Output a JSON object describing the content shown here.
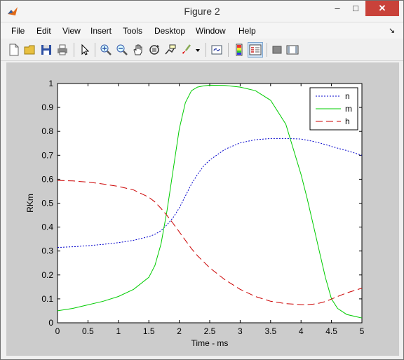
{
  "window": {
    "title": "Figure 2",
    "minimize_label": "–",
    "maximize_label": "□",
    "close_label": "✕"
  },
  "menu": [
    "File",
    "Edit",
    "View",
    "Insert",
    "Tools",
    "Desktop",
    "Window",
    "Help"
  ],
  "menu_arrow": "↘",
  "toolbar_icons": [
    "new-figure-icon",
    "open-file-icon",
    "save-icon",
    "print-icon",
    "edit-plot-arrow-icon",
    "zoom-in-icon",
    "zoom-out-icon",
    "pan-hand-icon",
    "rotate-3d-icon",
    "data-cursor-icon",
    "brush-icon",
    "brush-dropdown-icon",
    "link-plot-icon",
    "colorbar-icon",
    "legend-icon",
    "hide-plot-tools-icon",
    "show-plot-tools-icon"
  ],
  "chart_data": {
    "type": "line",
    "xlabel": "Time - ms",
    "ylabel": "RKm",
    "xlim": [
      0,
      5
    ],
    "ylim": [
      0,
      1
    ],
    "xticks": [
      "0",
      "0.5",
      "1",
      "1.5",
      "2",
      "2.5",
      "3",
      "3.5",
      "4",
      "4.5",
      "5"
    ],
    "yticks": [
      "0",
      "0.1",
      "0.2",
      "0.3",
      "0.4",
      "0.5",
      "0.6",
      "0.7",
      "0.8",
      "0.9",
      "1"
    ],
    "legend_position": "top-right",
    "x": [
      0,
      0.25,
      0.5,
      0.75,
      1.0,
      1.25,
      1.5,
      1.6,
      1.7,
      1.8,
      1.9,
      2.0,
      2.1,
      2.2,
      2.3,
      2.4,
      2.5,
      2.75,
      3.0,
      3.25,
      3.5,
      3.75,
      4.0,
      4.1,
      4.2,
      4.3,
      4.4,
      4.5,
      4.6,
      4.75,
      5.0
    ],
    "series": [
      {
        "name": "n",
        "color": "#0000cc",
        "dash": "2,2",
        "values": [
          0.315,
          0.318,
          0.322,
          0.328,
          0.335,
          0.345,
          0.36,
          0.37,
          0.385,
          0.41,
          0.44,
          0.48,
          0.53,
          0.58,
          0.62,
          0.655,
          0.68,
          0.725,
          0.752,
          0.765,
          0.77,
          0.77,
          0.768,
          0.763,
          0.758,
          0.752,
          0.745,
          0.737,
          0.73,
          0.72,
          0.7
        ]
      },
      {
        "name": "m",
        "color": "#00cc00",
        "dash": "",
        "values": [
          0.05,
          0.06,
          0.075,
          0.09,
          0.11,
          0.14,
          0.19,
          0.24,
          0.33,
          0.47,
          0.64,
          0.81,
          0.92,
          0.97,
          0.985,
          0.99,
          0.993,
          0.992,
          0.985,
          0.97,
          0.93,
          0.83,
          0.62,
          0.52,
          0.41,
          0.3,
          0.19,
          0.1,
          0.06,
          0.035,
          0.02
        ]
      },
      {
        "name": "h",
        "color": "#cc0000",
        "dash": "10,5",
        "values": [
          0.595,
          0.593,
          0.588,
          0.58,
          0.57,
          0.555,
          0.525,
          0.505,
          0.478,
          0.448,
          0.415,
          0.38,
          0.345,
          0.31,
          0.28,
          0.255,
          0.23,
          0.18,
          0.14,
          0.11,
          0.09,
          0.08,
          0.076,
          0.076,
          0.078,
          0.082,
          0.089,
          0.099,
          0.11,
          0.125,
          0.145
        ]
      }
    ]
  }
}
